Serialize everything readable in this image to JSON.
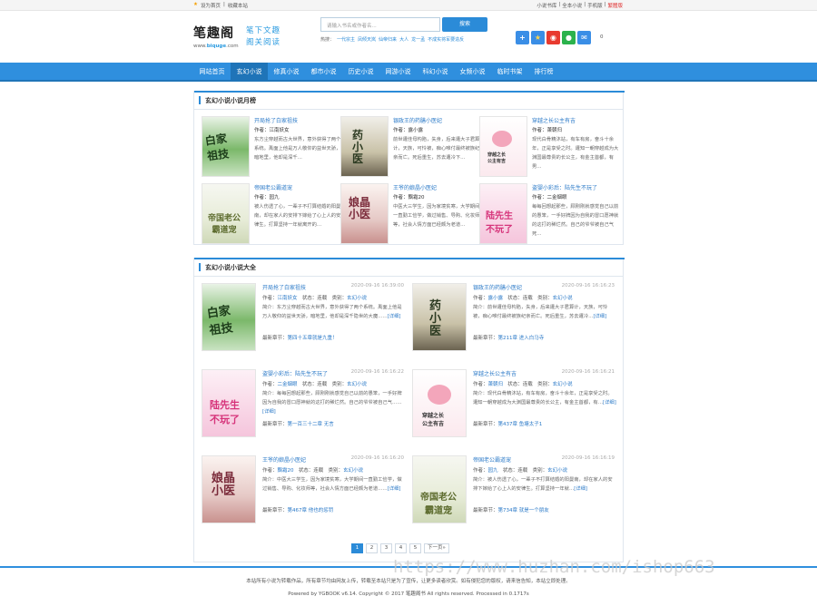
{
  "topbar": {
    "left": [
      "设为首页",
      "收藏本站"
    ],
    "right": [
      "小说书库",
      "全本小说",
      "手机版",
      "繁體版"
    ]
  },
  "logo": {
    "name": "笔趣阁",
    "url_prefix": "www.",
    "url_brand": "biquge",
    "url_suffix": ".com",
    "slogan1": "笔下文趣",
    "slogan2": "阁关阅读"
  },
  "search": {
    "placeholder": "请输入书名或作者名...",
    "button": "搜索",
    "hot_label": "热搜：",
    "hot": [
      "一代宗主",
      "凤倾天岚",
      "仙帝归来",
      "大人",
      "龙一孟",
      "不成实将军要造反"
    ]
  },
  "share": {
    "count": "0",
    "icons": [
      "plus-share",
      "star-share",
      "weibo-share",
      "wechat-share",
      "qzone-share"
    ]
  },
  "nav": [
    "网站首页",
    "玄幻小说",
    "修真小说",
    "都市小说",
    "历史小说",
    "网游小说",
    "科幻小说",
    "女频小说",
    "临时书架",
    "排行榜"
  ],
  "monthly": {
    "title": "玄幻小说小说月榜",
    "books": [
      {
        "title": "开局抢了白家祖技",
        "author": "作者：江南妖女",
        "desc": "东方尘穿越而古大世界，意外获得了两个系统。禹面上他是万人敬仰的益世天骄，暗地里，他却是深千…"
      },
      {
        "title": "银政王的药膳小医妃",
        "author": "作者：露小露",
        "desc": "前世遭佳母构陷，失身，后来遭大子君算计，天族，可怜被，痴心唯付最终被族纪亲而亡。死后重生，苏去遭冷下…"
      },
      {
        "title": "穿越之长公主有吉",
        "author": "作者：萧朝归",
        "desc": "现代白骨精沐站，有车有房，奋斗十余年，正是享受之时。遭知一朝穿越成为大渊国最尊贵的长公主，有金主首都，有男…"
      },
      {
        "title": "帝国老公霸道宠",
        "author": "作者：园九",
        "desc": "被人伤透了心，一辈子不打算结婚的阳曼南，却在家人的安排下嫁给了心上人的安律生。打算坚持一年就离开的…"
      },
      {
        "title": "王爷的娘晶小医妃",
        "author": "作者：飘霜20",
        "desc": "中医大三学生，因为家境贫寒，大学期间一直勤工俭学，做过销售、导购、化妆师等，社会人情方面已经颇为老道…"
      },
      {
        "title": "盗婴小彩后：陆先生不玩了",
        "author": "作者：二金烟眼",
        "desc": "每每回想起那些，顾刚刚就感觉自己以前的愚笨，一手好牌因为自我的冒口愿神就的这打的稀烂然。自己的爷爷被自己气死…"
      }
    ]
  },
  "all": {
    "title": "玄幻小说小说大全",
    "author_label": "作者：",
    "status_label": "状态：",
    "category_label": "类别：",
    "latest_label": "最新章节：",
    "books": [
      {
        "title": "开局抢了白家祖技",
        "time": "2020-09-16 16:39:00",
        "author": "江南妖女",
        "status": "连载",
        "category": "玄幻小说",
        "desc": "简介：东方尘穿越而古大世界，意外获得了两个系统。禹面上他是万人敬仰的益世天骄，暗地里，他却是深千隐世的大魔……",
        "more": "[详细]",
        "latest": "第四十五章就是九重！"
      },
      {
        "title": "银政王的药膳小医妃",
        "time": "2020-09-16 16:16:23",
        "author": "露小露",
        "status": "连载",
        "category": "玄幻小说",
        "desc": "简介：前世遭佳母构陷，失身，后来遭大子君算计，天族，可怜被，痴心唯付最终被族纪亲而亡。死后重生，苏去遭冷…",
        "more": "[详细]",
        "latest": "第211章 进入白马寺"
      },
      {
        "title": "盗婴小彩后：陆先生不玩了",
        "time": "2020-09-16 16:16:22",
        "author": "二金烟眼",
        "status": "连载",
        "category": "玄幻小说",
        "desc": "简介：每每回想起那些，顾刚刚就感觉自己以前的愚笨，一手好牌因为自我的冒口愿神就的这打的稀烂然。自己的爷爷被自己气……",
        "more": "[详细]",
        "latest": "第一百三十二章 无言"
      },
      {
        "title": "穿越之长公主有吉",
        "time": "2020-09-16 16:16:21",
        "author": "萧朝归",
        "status": "连载",
        "category": "玄幻小说",
        "desc": "简介：现代白骨精沐站，有车有房，奋斗十余年，正是享受之时。遭知一朝穿越成为大渊国最尊贵的长公主，有金主首都，有…",
        "more": "[详细]",
        "latest": "第437章 鱼塘太子1"
      },
      {
        "title": "王爷的娘晶小医妃",
        "time": "2020-09-16 16:16:20",
        "author": "飘霜20",
        "status": "连载",
        "category": "玄幻小说",
        "desc": "简介：中医大三学生，因为家境贫寒，大学期间一直勤工俭学，做过销售、导购、化妆师等，社会人情方面已经颇为老道……",
        "more": "[详细]",
        "latest": "第467章 他也的惩罚"
      },
      {
        "title": "帝国老公霸道宠",
        "time": "2020-09-16 16:16:19",
        "author": "园九",
        "status": "连载",
        "category": "玄幻小说",
        "desc": "简介：被人伤透了心，一辈子不打算结婚的阳曼南，却在家人的安排下嫁给了心上人的安律生。打算坚持一年就…",
        "more": "[详细]",
        "latest": "第734章 就是一个朋友"
      }
    ]
  },
  "pager": [
    "1",
    "2",
    "3",
    "4",
    "5",
    "下一页»"
  ],
  "footer": {
    "line1": "本站所有小说为转载作品，所有章节均由网友上传，转载至本站只是为了宣传，让更多读者欣赏。如有侵犯您的版权，请来信告知，本站立即处理。",
    "line2": "Powered by YGBOOK v6.14. Copyright © 2017 笔趣阁书 All rights reserved. Processed in 0.1717s"
  },
  "watermark": "https://www.huzhan.com/ishop663",
  "colors": {
    "accent": "#2f8fde",
    "nav_active": "#1f74b8",
    "link": "#2b7ac8"
  }
}
